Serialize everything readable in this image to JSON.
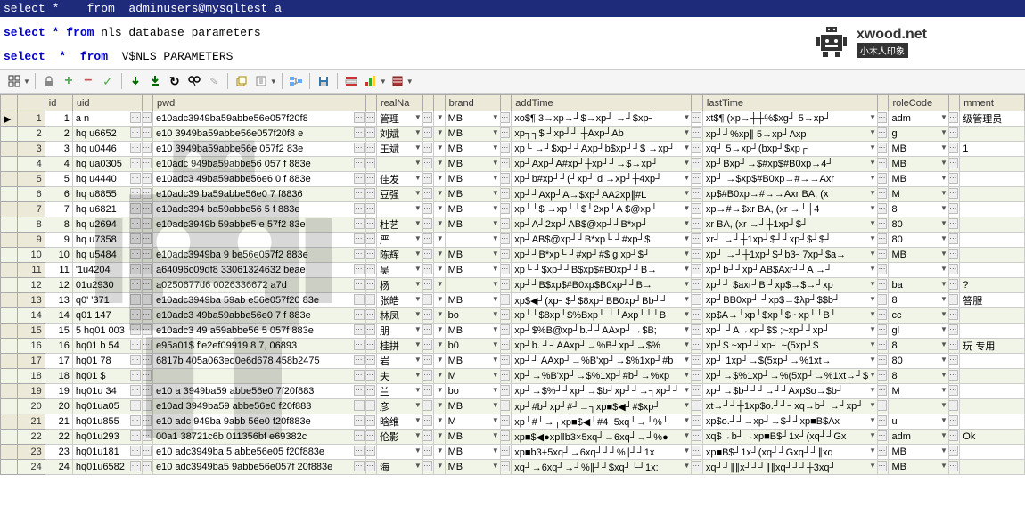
{
  "sql": {
    "line1_pre": "select *    from  adminusers@mysqltest a",
    "line2_kw": "select * from ",
    "line2_tbl": "nls_database_parameters",
    "line3_pre": "select  *  from  ",
    "line3_tbl": "V$NLS_PARAMETERS"
  },
  "logo": {
    "main": "xwood.net",
    "sub": "小木人印象"
  },
  "columns": [
    "",
    "",
    "id",
    "uid",
    "",
    "pwd",
    "",
    "realNa",
    "",
    "",
    "brand",
    "",
    "addTime",
    "",
    "lastTime",
    "",
    "roleCode",
    "",
    "mment"
  ],
  "rows": [
    {
      "n": 1,
      "id": 1,
      "uid": "a  n",
      "pwd": "e10adc3949ba59abbe56e057f20f8",
      "real": "管理",
      "brand": "MB",
      "add": "xo$¶ 3→xp→┘$→xp┘ →┘$xp┘",
      "last": "xt$¶ (xp→┼┼%$xg┘ 5→xp┘",
      "role": "adm",
      "mm": "级管理员"
    },
    {
      "n": 2,
      "id": 2,
      "uid": "hq  u6652",
      "pwd": "e10 3949ba59abbe56e057f20f8 e",
      "real": "刘斌",
      "brand": "MB",
      "add": "xp┐┐$ ┘xp┘┘ ┼Axp┘Ab",
      "last": "xp┘┘%xp∥ 5→xp┘Axp",
      "role": "g",
      "mm": ""
    },
    {
      "n": 3,
      "id": 3,
      "uid": "hq  u0446",
      "pwd": "e10 3949ba59abbe56e 057f2 83e",
      "real": "王斌",
      "brand": "MB",
      "add": "xp└ →┘$xp┘┘Axp┘b$xp┘┘$ →xp┘",
      "last": "xq┘ 5→xp┘(bxp┘$xp┌",
      "role": "MB",
      "mm": "1"
    },
    {
      "n": 4,
      "id": 4,
      "uid": "hq ua0305",
      "pwd": "e10adc 949ba59abbe56 057 f 883e",
      "real": "",
      "brand": "MB",
      "add": "xp┘Axp┘A#xp┘┼xp┘┘→$→xp┘",
      "last": "xp┘Bxp┘→$#xp$#B0xp→4┘",
      "role": "MB",
      "mm": ""
    },
    {
      "n": 5,
      "id": 5,
      "uid": "hq  u4440",
      "pwd": "e10adc3 49ba59abbe56e6 0 f 883e",
      "real": "佳发",
      "brand": "MB",
      "add": "xp┘b#xp┘┘(┘xp┘ d →xp┘┼4xp┘",
      "last": "xp┘ →$xp$#B0xp→#→→Axr",
      "role": "MB",
      "mm": ""
    },
    {
      "n": 6,
      "id": 6,
      "uid": "hq  u8855",
      "pwd": "e10adc39 ba59abbe56e0 7 f8836",
      "real": "豆强",
      "brand": "MB",
      "add": "xp┘┘Axp┘A→$xp┘AA2xp∥#L",
      "last": "xp$#B0xp→#→→Axr  BA, (x",
      "role": "M",
      "mm": ""
    },
    {
      "n": 7,
      "id": 7,
      "uid": "hq  u6821",
      "pwd": "e10adc394 ba59abbe56 5 f 883e",
      "real": "",
      "brand": "MB",
      "add": "xp┘┘$ →xp┘┘$┘2xp┘A $@xp┘",
      "last": "xp→#→$xr  BA, (xr →┘┼4",
      "role": "8",
      "mm": ""
    },
    {
      "n": 8,
      "id": 8,
      "uid": "hq  u2694",
      "pwd": "e10adc3949b 59abbe5 e 57f2 83e",
      "real": "杜艺",
      "brand": "MB",
      "add": "xp┘A┘2xp┘AB$@xp┘┘B*xp┘",
      "last": "xr  BA, (xr →┘┼1xp┘$┘",
      "role": "80",
      "mm": ""
    },
    {
      "n": 9,
      "id": 9,
      "uid": "hq  u7358",
      "pwd": "",
      "real": "严",
      "brand": "",
      "add": "xp┘AB$@xp┘┘B*xp└ ┘#xp┘$",
      "last": "xr┘ →┘┼1xp┘$┘┘xp┘$┘$┘",
      "role": "80",
      "mm": ""
    },
    {
      "n": 10,
      "id": 10,
      "uid": "hq  u5484",
      "pwd": "e10adc3949ba 9 be56e057f2 883e",
      "real": "陈辉",
      "brand": "MB",
      "add": "xp┘┘B*xp└ ┘#xp┘#$ g xp┘$┘",
      "last": "xp┘ →┘┼1xp┘$┘b3┘7xp┘$a→",
      "role": "MB",
      "mm": ""
    },
    {
      "n": 11,
      "id": 11,
      "uid": "  '1u4204",
      "pwd": "a64096c09df8  33061324632 beae",
      "real": "吴",
      "brand": "MB",
      "add": "xp└ ┘$xp┘┘B$xp$#B0xp┘┘B→",
      "last": "xp┘b┘┘xp┘AB$Axr┘┘A →┘",
      "role": "",
      "mm": ""
    },
    {
      "n": 12,
      "id": 12,
      "uid": " 01u2930",
      "pwd": "a0250677d6   0026336672 a7d",
      "real": "杨",
      "brand": "",
      "add": "xp┘┘B$xp$#B0xp$B0xp┘┘B→",
      "last": "xp┘┘ $axr┘B  ┘xp$→$→┘xp",
      "role": "ba",
      "mm": "?"
    },
    {
      "n": 13,
      "id": 13,
      "uid": " q0' '371",
      "pwd": "e10adc3949ba 59ab e56e057f20 83e",
      "real": "张皓",
      "brand": "MB",
      "add": "xp$◀┘(xp┘$┘$8xp┘BB0xp┘Bb┘┘",
      "last": "xp┘BB0xp┘ ┘xp$→$λp┘$$b┘",
      "role": "8",
      "mm": "答服"
    },
    {
      "n": 14,
      "id": 14,
      "uid": " q01   147",
      "pwd": "e10adc3 49ba59abbe56e0 7 f 883e",
      "real": "林凤",
      "brand": "bo",
      "add": "xp┘┘$8xp┘$%Bxp┘ ┘┘Axp┘┘┘B",
      "last": "xp$A→┘xp┘$xp┘$ ~xp┘┘B┘",
      "role": "cc",
      "mm": ""
    },
    {
      "n": 15,
      "id": 15,
      "uid": "5 hq01 003",
      "pwd": "e10adc3 49 a59abbe56 5 057f 883e",
      "real": "朋",
      "brand": "MB",
      "add": "xp┘$%B@xp┘b.┘┘AAxp┘→$B;",
      "last": "xp┘ ┘A→xp┘$$ ;~xp┘┘xp┘",
      "role": "gl",
      "mm": ""
    },
    {
      "n": 16,
      "id": 16,
      "uid": "hq01 b 54",
      "pwd": "e95a01$ f'e2ef09919 8 7, 06893",
      "real": "桂拼",
      "brand": "b0",
      "add": "xp┘b. ┘┘AAxp┘→%B┘xp┘→$%",
      "last": "xp┘$ ~xp┘┘xp┘ ~(5xp┘$",
      "role": "8",
      "mm": "玩  专用"
    },
    {
      "n": 17,
      "id": 17,
      "uid": "hq01  78",
      "pwd": "6817b 405a063ed0e6d678 458b2475",
      "real": "岩",
      "brand": "MB",
      "add": "xp┘┘ AAxp┘→%B'xp┘→$%1xp┘#b",
      "last": "xp┘  1xp┘→$(5xp┘→%1xt→",
      "role": "80",
      "mm": ""
    },
    {
      "n": 18,
      "id": 18,
      "uid": "hq01 $",
      "pwd": "",
      "real": "夫",
      "brand": "M",
      "add": "xp┘→%B'xp┘→$%1xp┘#b┘→%xp",
      "last": "xp┘→$%1xp┘→%(5xp┘→%1xt→┘$",
      "role": "8",
      "mm": ""
    },
    {
      "n": 19,
      "id": 19,
      "uid": "hq01u 34",
      "pwd": "e10 a 3949ba59 abbe56e0 7f20f883",
      "real": "兰",
      "brand": "bo",
      "add": "xp┘→$%┘┘xp┘→$b┘xp┘┘→┐xp┘┘",
      "last": "xp┘→$b┘┘┘→┘┘Axp$o→$b┘",
      "role": "M",
      "mm": ""
    },
    {
      "n": 20,
      "id": 20,
      "uid": "hq01ua05",
      "pwd": "e10ad 3949ba59 abbe56e0  f20f883",
      "real": "彦",
      "brand": "MB",
      "add": "xp┘#b┘xp┘#┘→┐xp■$◀┘#$xp┘",
      "last": "xt→┘┘┼1xp$o.┘┘┘xq→b┘ →┘xp┘",
      "role": "",
      "mm": ""
    },
    {
      "n": 21,
      "id": 21,
      "uid": "hq01u855",
      "pwd": "e10 adc 949ba 9abb 56e0 f20f883e",
      "real": "晗维",
      "brand": "M",
      "add": "xp┘#┘→┐xp■$◀┘#4+5xq┘→┘%┘",
      "last": "xp$o.┘┘→xp┘→$┘┘xp■B$Ax",
      "role": "u",
      "mm": ""
    },
    {
      "n": 22,
      "id": 22,
      "uid": "hq01u293",
      "pwd": "00a1 38721c6b 011356bf e69382c",
      "real": "伦影",
      "brand": "MB",
      "add": "xp■$◀●xpⅡb3×5xq┘→6xq┘→┘%●",
      "last": "xq$→b┘→xp■B$┘1x┘(xq┘┘Gx",
      "role": "adm",
      "mm": "Ok"
    },
    {
      "n": 23,
      "id": 23,
      "uid": "hq01u181",
      "pwd": "e10 adc3949ba 5 abbe56e05 f20f883e",
      "real": "",
      "brand": "MB",
      "add": "xp■b3+5xq┘→6xq┘┘┘%∥┘┘1x",
      "last": "xp■B$┘1x┘(xq┘┘Gxq┘┘∥xq",
      "role": "MB",
      "mm": ""
    },
    {
      "n": 24,
      "id": 24,
      "uid": "hq01u6582",
      "pwd": "e10 adc3949ba5 9abbe56e057f 20f883e",
      "real": "海",
      "brand": "MB",
      "add": "xq┘→6xq┘→┘%∥┘┘$xq┘└┘1x:",
      "last": "xq┘┘∥∥x┘┘┘∥∥xq┘┘┘┼3xq┘",
      "role": "MB",
      "mm": ""
    }
  ]
}
